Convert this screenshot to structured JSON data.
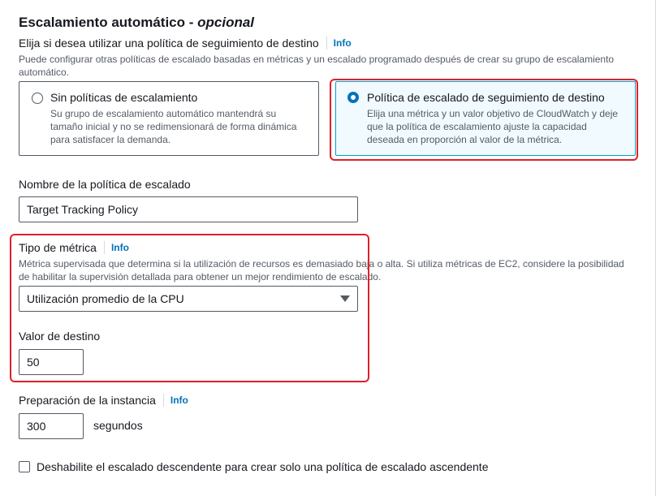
{
  "section": {
    "title": "Escalamiento automático - ",
    "title_optional": "opcional"
  },
  "policy_choice": {
    "label": "Elija si desea utilizar una política de seguimiento de destino",
    "info": "Info",
    "description": "Puede configurar otras políticas de escalado basadas en métricas y un escalado programado después de crear su grupo de escalamiento automático.",
    "options": [
      {
        "title": "Sin políticas de escalamiento",
        "description": "Su grupo de escalamiento automático mantendrá su tamaño inicial y no se redimensionará de forma dinámica para satisfacer la demanda.",
        "selected": false
      },
      {
        "title": "Política de escalado de seguimiento de destino",
        "description": "Elija una métrica y un valor objetivo de CloudWatch y deje que la política de escalamiento ajuste la capacidad deseada en proporción al valor de la métrica.",
        "selected": true
      }
    ]
  },
  "policy_name": {
    "label": "Nombre de la política de escalado",
    "value": "Target Tracking Policy"
  },
  "metric_type": {
    "label": "Tipo de métrica",
    "info": "Info",
    "description": "Métrica supervisada que determina si la utilización de recursos es demasiado baja o alta. Si utiliza métricas de EC2, considere la posibilidad de habilitar la supervisión detallada para obtener un mejor rendimiento de escalado.",
    "selected": "Utilización promedio de la CPU"
  },
  "target_value": {
    "label": "Valor de destino",
    "value": "50"
  },
  "instance_warmup": {
    "label": "Preparación de la instancia",
    "info": "Info",
    "value": "300",
    "unit": "segundos"
  },
  "disable_scale_in": {
    "label": "Deshabilite el escalado descendente para crear solo una política de escalado ascendente",
    "checked": false
  },
  "colors": {
    "highlight": "#e0202a",
    "link": "#0073bb",
    "selected_tile_border": "#00a1c9",
    "selected_tile_bg": "#f1faff"
  }
}
